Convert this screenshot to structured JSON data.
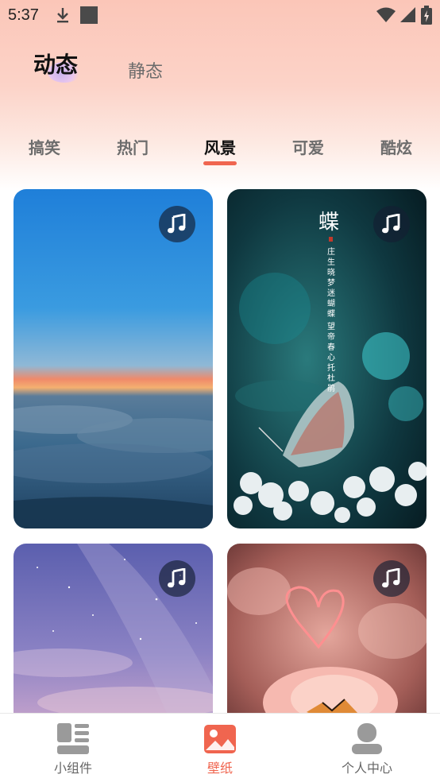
{
  "status_bar": {
    "time": "5:37",
    "icons": [
      "download-icon",
      "square-notification-icon",
      "wifi-icon",
      "signal-icon",
      "battery-charging-icon"
    ]
  },
  "main_tabs": [
    {
      "label": "动态",
      "active": true
    },
    {
      "label": "静态",
      "active": false
    }
  ],
  "category_tabs": [
    {
      "label": "搞笑",
      "active": false
    },
    {
      "label": "热门",
      "active": false
    },
    {
      "label": "风景",
      "active": true
    },
    {
      "label": "可爱",
      "active": false
    },
    {
      "label": "酷炫",
      "active": false
    }
  ],
  "wallpapers": [
    {
      "scene": "sky above clouds at sunset",
      "badge": "music-note-icon"
    },
    {
      "scene": "butterfly on white flowers with calligraphy",
      "badge": "music-note-icon",
      "calligraphy_title": "蝶",
      "calligraphy_text": "庄生晓梦迷蝴蝶 望帝春心托杜鹃"
    },
    {
      "scene": "purple starry sky",
      "badge": "music-note-icon"
    },
    {
      "scene": "pink rose with neon heart",
      "badge": "music-note-icon"
    }
  ],
  "bottom_nav": [
    {
      "label": "小组件",
      "icon": "widgets-icon",
      "active": false
    },
    {
      "label": "壁纸",
      "icon": "image-icon",
      "active": true
    },
    {
      "label": "个人中心",
      "icon": "person-icon",
      "active": false
    }
  ],
  "colors": {
    "accent": "#f0654f",
    "header_gradient_top": "#fbc6b8"
  }
}
